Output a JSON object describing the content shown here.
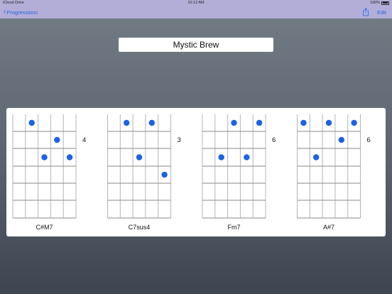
{
  "status_bar": {
    "carrier": "iCloud Drive",
    "time": "10:12 AM",
    "battery": "100%"
  },
  "nav": {
    "back_label": "Progressions",
    "edit_label": "Edit",
    "share_icon": "share-icon"
  },
  "progression_title": "Mystic Brew",
  "colors": {
    "nav_background": "#b3aed8",
    "tint": "#1f66e0",
    "dot": "#1a62e8"
  },
  "chords": [
    {
      "name": "C#M7",
      "fret": "4",
      "dots": [
        {
          "string": 2,
          "fret": 1
        },
        {
          "string": 4,
          "fret": 2
        },
        {
          "string": 3,
          "fret": 3
        },
        {
          "string": 5,
          "fret": 3
        }
      ]
    },
    {
      "name": "C7sus4",
      "fret": "3",
      "dots": [
        {
          "string": 2,
          "fret": 1
        },
        {
          "string": 4,
          "fret": 1
        },
        {
          "string": 3,
          "fret": 3
        },
        {
          "string": 5,
          "fret": 4
        }
      ]
    },
    {
      "name": "Fm7",
      "fret": "6",
      "dots": [
        {
          "string": 3,
          "fret": 1
        },
        {
          "string": 5,
          "fret": 1
        },
        {
          "string": 2,
          "fret": 3
        },
        {
          "string": 4,
          "fret": 3
        }
      ]
    },
    {
      "name": "A#7",
      "fret": "6",
      "dots": [
        {
          "string": 1,
          "fret": 1
        },
        {
          "string": 3,
          "fret": 1
        },
        {
          "string": 5,
          "fret": 1
        },
        {
          "string": 4,
          "fret": 2
        },
        {
          "string": 2,
          "fret": 3
        }
      ]
    }
  ]
}
